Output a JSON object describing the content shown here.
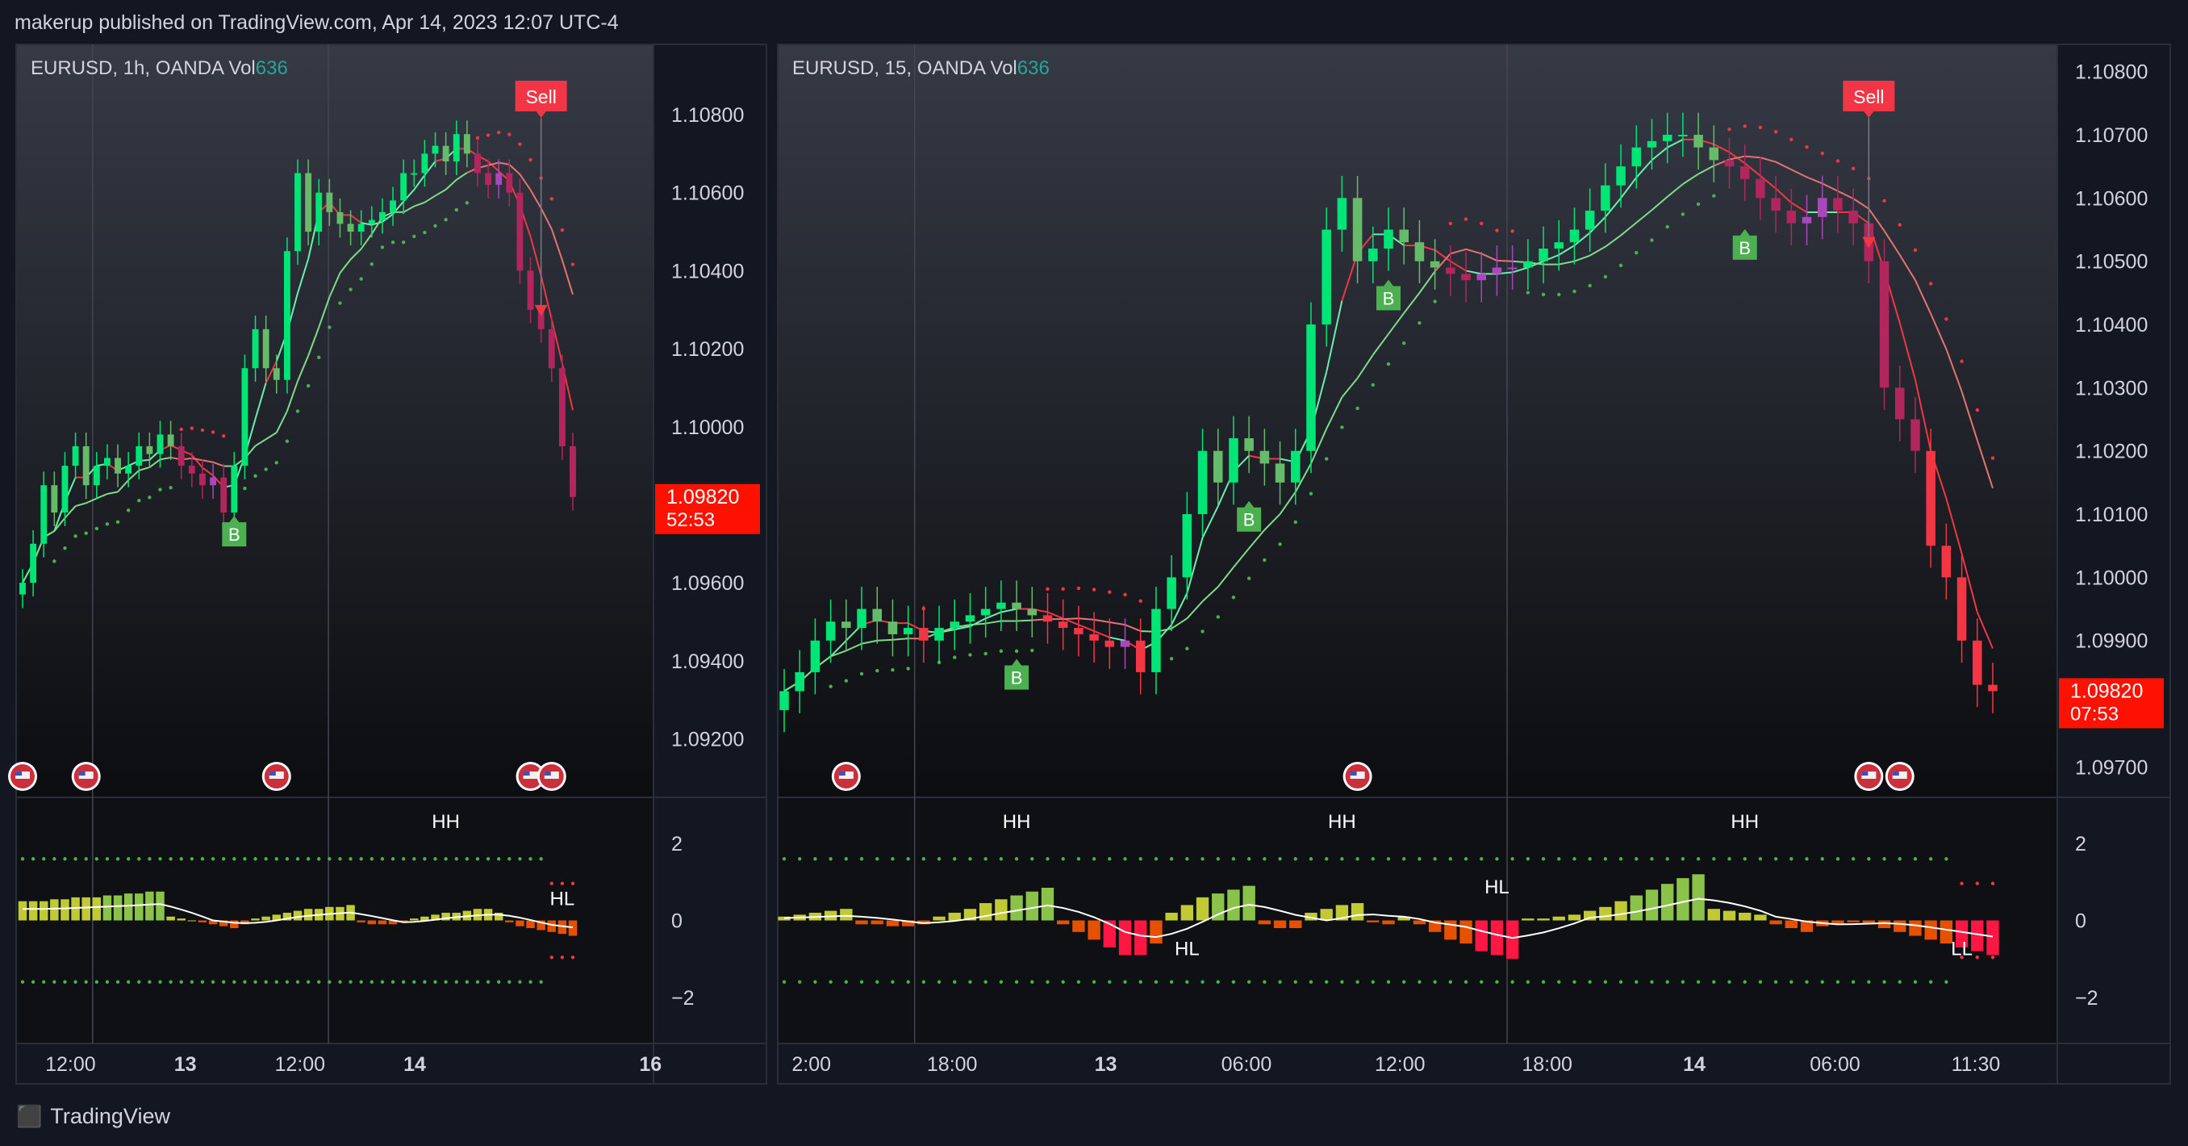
{
  "header": {
    "published": "makerup published on TradingView.com, Apr 14, 2023 12:07 UTC-4"
  },
  "footer": {
    "brand": "TradingView",
    "logo_icon": "tradingview-logo-icon"
  },
  "colors": {
    "bull": "#00e676",
    "bull_dim": "#4caf50",
    "bear": "#f23645",
    "bear_dim": "#b2265e",
    "flag": "#cc2f3c",
    "hist_pos": "#8bc34a",
    "hist_pos_high": "#c0ca33",
    "hist_neg": "#e65100",
    "hist_neg_low": "#ff1744",
    "buy_badge": "#4caf50",
    "sell_badge": "#f23645",
    "vol": "#26a69a",
    "price_tag": "#ff1100"
  },
  "chart_data": [
    {
      "type": "candlestick",
      "symbol": "EURUSD",
      "interval": "1h",
      "exchange": "OANDA",
      "vol_label": "Vol",
      "vol_value": "636",
      "price_ticks": [
        "1.10800",
        "1.10600",
        "1.10400",
        "1.10200",
        "1.10000",
        "1.09600",
        "1.09400",
        "1.09200"
      ],
      "price_tick_values": [
        1.108,
        1.106,
        1.104,
        1.102,
        1.1,
        1.096,
        1.094,
        1.092
      ],
      "ylim": [
        1.0905,
        1.1098
      ],
      "last_price": "1.09820",
      "last_price_value": 1.0982,
      "countdown": "52:53",
      "time_ticks": [
        {
          "label": "12:00",
          "bold": false,
          "pos": 0.06
        },
        {
          "label": "13",
          "bold": true,
          "pos": 0.24
        },
        {
          "label": "12:00",
          "bold": false,
          "pos": 0.42
        },
        {
          "label": "14",
          "bold": true,
          "pos": 0.6
        },
        {
          "label": "16",
          "bold": true,
          "pos": 0.97
        }
      ],
      "vlines": [
        0.12,
        0.49
      ],
      "closes": [
        1.096,
        1.097,
        1.0985,
        1.0978,
        1.099,
        1.0995,
        1.0985,
        1.099,
        1.0992,
        1.0988,
        1.099,
        1.0995,
        1.0993,
        1.0998,
        1.0995,
        1.099,
        1.0988,
        1.0985,
        1.0987,
        1.0978,
        1.099,
        1.1015,
        1.1025,
        1.1015,
        1.1012,
        1.1045,
        1.1065,
        1.105,
        1.106,
        1.1055,
        1.1052,
        1.105,
        1.1052,
        1.1053,
        1.1055,
        1.1058,
        1.1065,
        1.1065,
        1.107,
        1.1072,
        1.1068,
        1.1075,
        1.107,
        1.1065,
        1.1062,
        1.1065,
        1.106,
        1.104,
        1.103,
        1.1025,
        1.1015,
        1.0995,
        1.0982
      ],
      "signals": [
        {
          "label": "B",
          "index": 20,
          "side": "buy"
        },
        {
          "label": "Sell",
          "index": 49,
          "side": "sell"
        }
      ],
      "events": [
        0,
        6,
        24,
        48,
        50
      ],
      "oscillator": {
        "yticks": [
          "2",
          "0",
          "−2"
        ],
        "ytick_values": [
          2,
          0,
          -2
        ],
        "ylim": [
          -3.2,
          3.2
        ],
        "band": 1.6,
        "labels": [
          {
            "text": "HH",
            "index": 40,
            "value": 2.4
          },
          {
            "text": "HL",
            "index": 51,
            "value": 0.4
          }
        ],
        "hist": [
          0.5,
          0.5,
          0.5,
          0.55,
          0.55,
          0.6,
          0.6,
          0.6,
          0.65,
          0.65,
          0.7,
          0.7,
          0.75,
          0.75,
          0.1,
          0.05,
          0.0,
          -0.05,
          -0.1,
          -0.15,
          -0.2,
          -0.1,
          0.05,
          0.1,
          0.15,
          0.2,
          0.25,
          0.3,
          0.3,
          0.35,
          0.35,
          0.4,
          -0.05,
          -0.1,
          -0.1,
          -0.1,
          -0.05,
          0.05,
          0.1,
          0.15,
          0.2,
          0.2,
          0.25,
          0.3,
          0.3,
          0.2,
          -0.05,
          -0.15,
          -0.2,
          -0.25,
          -0.3,
          -0.35,
          -0.4
        ]
      }
    },
    {
      "type": "candlestick",
      "symbol": "EURUSD",
      "interval": "15",
      "exchange": "OANDA",
      "vol_label": "Vol",
      "vol_value": "636",
      "price_ticks": [
        "1.10800",
        "1.10700",
        "1.10600",
        "1.10500",
        "1.10400",
        "1.10300",
        "1.10200",
        "1.10100",
        "1.10000",
        "1.09900",
        "1.09800",
        "1.09700"
      ],
      "price_tick_values": [
        1.108,
        1.107,
        1.106,
        1.105,
        1.104,
        1.103,
        1.102,
        1.101,
        1.1,
        1.099,
        1.098,
        1.097
      ],
      "ylim": [
        1.09652,
        1.10843
      ],
      "last_price": "1.09820",
      "last_price_value": 1.0982,
      "countdown": "07:53",
      "time_ticks": [
        {
          "label": "2:00",
          "bold": false,
          "pos": 0.02
        },
        {
          "label": "18:00",
          "bold": false,
          "pos": 0.13
        },
        {
          "label": "13",
          "bold": true,
          "pos": 0.25
        },
        {
          "label": "06:00",
          "bold": false,
          "pos": 0.36
        },
        {
          "label": "12:00",
          "bold": false,
          "pos": 0.48
        },
        {
          "label": "18:00",
          "bold": false,
          "pos": 0.595
        },
        {
          "label": "14",
          "bold": true,
          "pos": 0.71
        },
        {
          "label": "06:00",
          "bold": false,
          "pos": 0.82
        },
        {
          "label": "11:30",
          "bold": false,
          "pos": 0.93
        }
      ],
      "vlines": [
        0.107,
        0.57
      ],
      "closes": [
        1.0982,
        1.0985,
        1.099,
        1.0993,
        1.0992,
        1.0995,
        1.0993,
        1.0991,
        1.0992,
        1.099,
        1.0992,
        1.0993,
        1.0994,
        1.0995,
        1.0996,
        1.0995,
        1.0994,
        1.0993,
        1.0992,
        1.0991,
        1.099,
        1.0989,
        1.099,
        1.0985,
        1.0995,
        1.1,
        1.101,
        1.102,
        1.1015,
        1.1022,
        1.102,
        1.1018,
        1.1015,
        1.102,
        1.104,
        1.1055,
        1.106,
        1.105,
        1.1052,
        1.1055,
        1.1053,
        1.105,
        1.1049,
        1.1048,
        1.1047,
        1.1048,
        1.1049,
        1.1049,
        1.105,
        1.1052,
        1.1053,
        1.1055,
        1.1058,
        1.1062,
        1.1065,
        1.1068,
        1.1069,
        1.107,
        1.107,
        1.1068,
        1.1066,
        1.1065,
        1.1063,
        1.106,
        1.1058,
        1.1056,
        1.1057,
        1.106,
        1.1058,
        1.1056,
        1.105,
        1.103,
        1.1025,
        1.102,
        1.1005,
        1.1,
        1.099,
        1.0983,
        1.0982
      ],
      "signals": [
        {
          "label": "B",
          "index": 15,
          "side": "buy"
        },
        {
          "label": "B",
          "index": 30,
          "side": "buy"
        },
        {
          "label": "B",
          "index": 39,
          "side": "buy"
        },
        {
          "label": "B",
          "index": 62,
          "side": "buy"
        },
        {
          "label": "Sell",
          "index": 70,
          "side": "sell"
        }
      ],
      "events": [
        4,
        37,
        70,
        72
      ],
      "oscillator": {
        "yticks": [
          "2",
          "0",
          "−2"
        ],
        "ytick_values": [
          2,
          0,
          -2
        ],
        "ylim": [
          -3.2,
          3.2
        ],
        "band": 1.6,
        "labels": [
          {
            "text": "HH",
            "index": 15,
            "value": 2.4
          },
          {
            "text": "HL",
            "index": 26,
            "value": -0.9
          },
          {
            "text": "HH",
            "index": 36,
            "value": 2.4
          },
          {
            "text": "HL",
            "index": 46,
            "value": 0.7
          },
          {
            "text": "HH",
            "index": 62,
            "value": 2.4
          },
          {
            "text": "LL",
            "index": 76,
            "value": -0.9
          }
        ],
        "hist": [
          0.1,
          0.15,
          0.2,
          0.25,
          0.3,
          -0.1,
          -0.1,
          -0.15,
          -0.15,
          -0.1,
          0.1,
          0.2,
          0.3,
          0.45,
          0.55,
          0.65,
          0.75,
          0.85,
          -0.1,
          -0.3,
          -0.5,
          -0.7,
          -0.9,
          -0.9,
          -0.6,
          0.2,
          0.4,
          0.6,
          0.7,
          0.8,
          0.9,
          -0.1,
          -0.2,
          -0.2,
          0.2,
          0.3,
          0.4,
          0.45,
          -0.05,
          -0.1,
          0.1,
          -0.1,
          -0.3,
          -0.5,
          -0.6,
          -0.8,
          -0.9,
          -1.0,
          0.05,
          0.05,
          0.1,
          0.15,
          0.25,
          0.35,
          0.5,
          0.65,
          0.8,
          0.95,
          1.1,
          1.2,
          0.3,
          0.25,
          0.2,
          0.15,
          -0.1,
          -0.2,
          -0.3,
          -0.15,
          -0.1,
          -0.05,
          -0.1,
          -0.2,
          -0.3,
          -0.4,
          -0.5,
          -0.6,
          -0.7,
          -0.8,
          -0.9
        ]
      }
    }
  ]
}
